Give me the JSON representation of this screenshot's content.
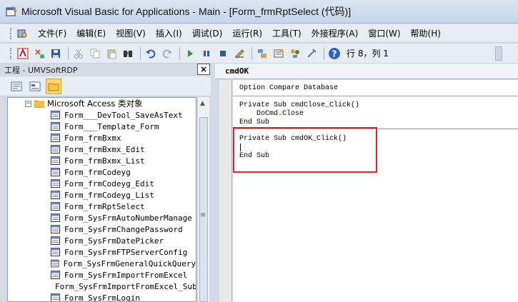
{
  "window": {
    "title": "Microsoft Visual Basic for Applications - Main - [Form_frmRptSelect (代码)]"
  },
  "menu": {
    "items": [
      "文件(F)",
      "编辑(E)",
      "视图(V)",
      "插入(I)",
      "调试(D)",
      "运行(R)",
      "工具(T)",
      "外接程序(A)",
      "窗口(W)",
      "帮助(H)"
    ]
  },
  "toolbar": {
    "position_text": "行 8，列 1"
  },
  "project": {
    "title": "工程 - UMVSoftRDP",
    "close_label": "×",
    "root_label": "Microsoft Access 类对象",
    "items": [
      "Form___DevTool_SaveAsText",
      "Form___Template_Form",
      "Form_frmBxmx",
      "Form_frmBxmx_Edit",
      "Form_frmBxmx_List",
      "Form_frmCodeyg",
      "Form_frmCodeyg_Edit",
      "Form_frmCodeyg_List",
      "Form_frmRptSelect",
      "Form_SysFrmAutoNumberManage",
      "Form_SysFrmChangePassword",
      "Form_SysFrmDatePicker",
      "Form_SysFrmFTPServerConfig",
      "Form_SysFrmGeneralQuickQuery",
      "Form_SysFrmImportFromExcel",
      "Form_SysFrmImportFromExcel_Sub",
      "Form_SysFrmLogin"
    ]
  },
  "code": {
    "object_name": "cmdOK",
    "lines": {
      "l1": "Option Compare Database",
      "l2": "Private Sub cmdClose_Click()",
      "l3": "    DoCmd.Close",
      "l4": "End Sub",
      "l5": "Private Sub cmdOK_Click()",
      "l6": "End Sub"
    }
  },
  "colors": {
    "highlight": "#d6252b",
    "active_folder": "#fbd86b"
  }
}
